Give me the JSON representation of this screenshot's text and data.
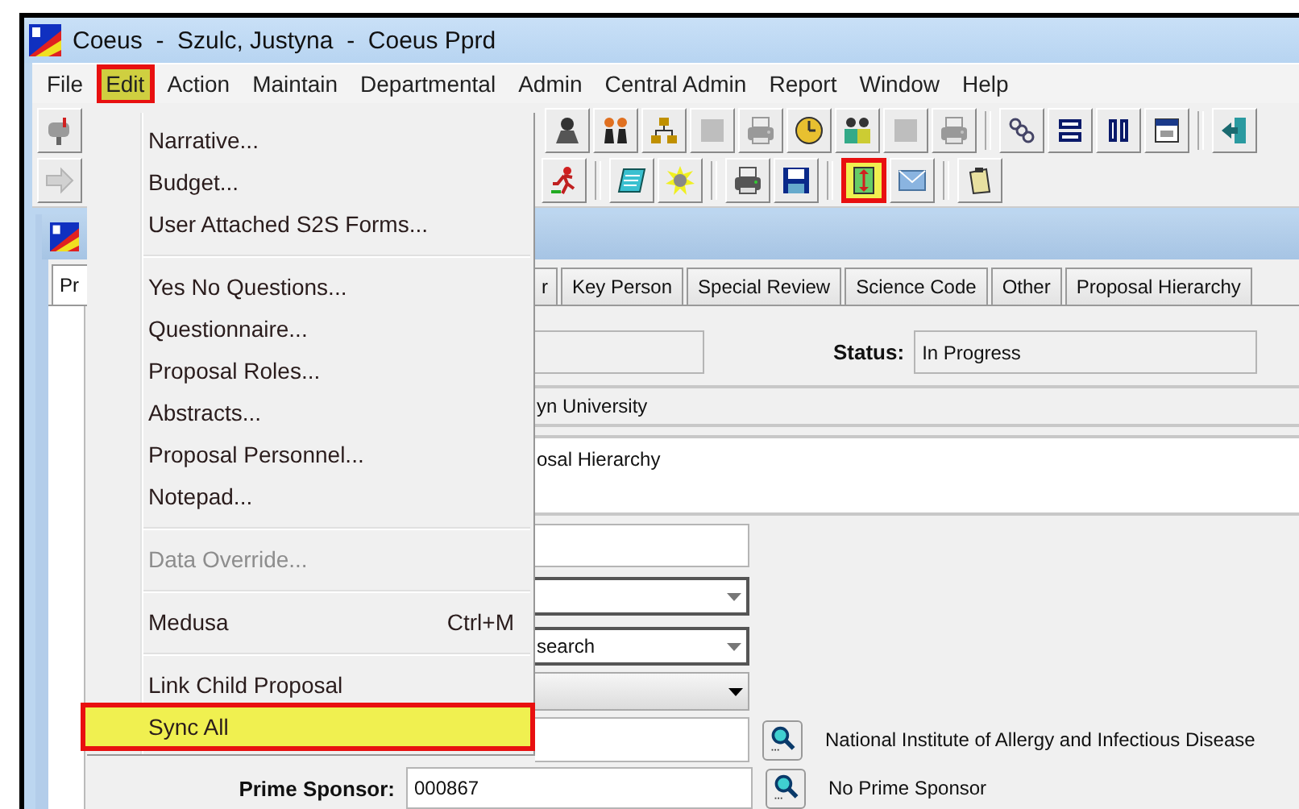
{
  "window": {
    "title": "Coeus  -  Szulc, Justyna  -  Coeus Pprd"
  },
  "menu_bar": [
    {
      "label": "File",
      "selected": false
    },
    {
      "label": "Edit",
      "selected": true
    },
    {
      "label": "Action",
      "selected": false
    },
    {
      "label": "Maintain",
      "selected": false
    },
    {
      "label": "Departmental",
      "selected": false
    },
    {
      "label": "Admin",
      "selected": false
    },
    {
      "label": "Central Admin",
      "selected": false
    },
    {
      "label": "Report",
      "selected": false
    },
    {
      "label": "Window",
      "selected": false
    },
    {
      "label": "Help",
      "selected": false
    }
  ],
  "toolbar_rows": [
    [
      {
        "kind": "button",
        "disabled": false,
        "highlighted": false
      },
      {
        "kind": "gap"
      },
      {
        "kind": "button",
        "disabled": false,
        "highlighted": false
      },
      {
        "kind": "button",
        "disabled": false,
        "highlighted": false
      },
      {
        "kind": "button",
        "disabled": false,
        "highlighted": false
      },
      {
        "kind": "button",
        "disabled": true,
        "highlighted": false
      },
      {
        "kind": "button",
        "disabled": true,
        "highlighted": false
      },
      {
        "kind": "button",
        "disabled": false,
        "highlighted": false
      },
      {
        "kind": "button",
        "disabled": false,
        "highlighted": false
      },
      {
        "kind": "button",
        "disabled": true,
        "highlighted": false
      },
      {
        "kind": "button",
        "disabled": true,
        "highlighted": false
      },
      {
        "kind": "separator"
      },
      {
        "kind": "button",
        "disabled": false,
        "highlighted": false
      },
      {
        "kind": "button",
        "disabled": false,
        "highlighted": false
      },
      {
        "kind": "button",
        "disabled": false,
        "highlighted": false
      },
      {
        "kind": "button",
        "disabled": false,
        "highlighted": false
      },
      {
        "kind": "separator"
      },
      {
        "kind": "button",
        "disabled": false,
        "highlighted": false
      }
    ],
    [
      {
        "kind": "button",
        "disabled": true,
        "highlighted": false
      },
      {
        "kind": "gap"
      },
      {
        "kind": "button",
        "disabled": false,
        "highlighted": false
      },
      {
        "kind": "separator"
      },
      {
        "kind": "button",
        "disabled": false,
        "highlighted": false
      },
      {
        "kind": "button",
        "disabled": false,
        "highlighted": false
      },
      {
        "kind": "separator"
      },
      {
        "kind": "button",
        "disabled": false,
        "highlighted": false
      },
      {
        "kind": "button",
        "disabled": false,
        "highlighted": false
      },
      {
        "kind": "separator"
      },
      {
        "kind": "button",
        "disabled": false,
        "highlighted": true
      },
      {
        "kind": "button",
        "disabled": false,
        "highlighted": false
      },
      {
        "kind": "separator"
      },
      {
        "kind": "button",
        "disabled": false,
        "highlighted": false
      }
    ]
  ],
  "edit_menu": {
    "items": [
      {
        "kind": "item",
        "label": "Narrative...",
        "disabled": false,
        "highlighted": false
      },
      {
        "kind": "item",
        "label": "Budget...",
        "disabled": false,
        "highlighted": false
      },
      {
        "kind": "item",
        "label": "User Attached S2S Forms...",
        "disabled": false,
        "highlighted": false
      },
      {
        "kind": "separator"
      },
      {
        "kind": "item",
        "label": "Yes No Questions...",
        "disabled": false,
        "highlighted": false
      },
      {
        "kind": "item",
        "label": "Questionnaire...",
        "disabled": false,
        "highlighted": false
      },
      {
        "kind": "item",
        "label": "Proposal Roles...",
        "disabled": false,
        "highlighted": false
      },
      {
        "kind": "item",
        "label": "Abstracts...",
        "disabled": false,
        "highlighted": false
      },
      {
        "kind": "item",
        "label": "Proposal Personnel...",
        "disabled": false,
        "highlighted": false
      },
      {
        "kind": "item",
        "label": "Notepad...",
        "disabled": false,
        "highlighted": false
      },
      {
        "kind": "separator"
      },
      {
        "kind": "item",
        "label": "Data Override...",
        "disabled": true,
        "highlighted": false
      },
      {
        "kind": "separator"
      },
      {
        "kind": "item",
        "label": "Medusa",
        "shortcut": "Ctrl+M",
        "disabled": false,
        "highlighted": false
      },
      {
        "kind": "separator"
      },
      {
        "kind": "item",
        "label": "Link Child Proposal",
        "disabled": false,
        "highlighted": false
      },
      {
        "kind": "item",
        "label": "Sync All",
        "disabled": false,
        "highlighted": true
      }
    ]
  },
  "tabs": [
    {
      "label": "Pr",
      "selected": true
    },
    {
      "label": "r",
      "selected": false
    },
    {
      "label": "Key Person",
      "selected": false
    },
    {
      "label": "Special Review",
      "selected": false
    },
    {
      "label": "Science Code",
      "selected": false
    },
    {
      "label": "Other",
      "selected": false
    },
    {
      "label": "Proposal Hierarchy",
      "selected": false
    }
  ],
  "form": {
    "status": {
      "label": "Status:",
      "value": "In Progress"
    },
    "unit_line": {
      "text": "yn University"
    },
    "text_area": {
      "text": "osal Hierarchy"
    },
    "dropdowns": [
      {
        "kind": "editable"
      },
      {
        "kind": "editable",
        "value": "search"
      },
      {
        "kind": "button"
      }
    ],
    "sponsor": {
      "name": "National Institute of Allergy and Infectious Disease"
    },
    "prime_sponsor": {
      "label": "Prime Sponsor:",
      "value": "000867",
      "name": "No Prime Sponsor"
    }
  }
}
